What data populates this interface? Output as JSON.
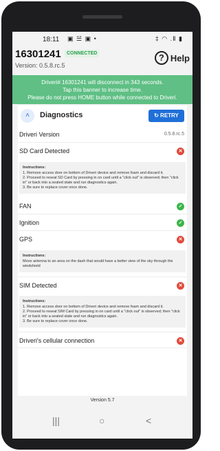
{
  "status_bar": {
    "time": "18:11",
    "left_icons": "▣ ☱ ▣ •",
    "right_icons": "‡ ◠ .Ⅱ ▮"
  },
  "header": {
    "device_id": "16301241",
    "connection_badge": "CONNECTED",
    "version": "Version: 0.5.8.rc.5",
    "help_label": "Help",
    "help_icon": "?"
  },
  "banner": {
    "line1": "Driveri# 16301241 will disconnect in 343 seconds.",
    "line2": "Tap this banner to increase time.",
    "line3": "Please do not press HOME button while connected to Driveri."
  },
  "diagnostics": {
    "title": "Diagnostics",
    "retry_label": "RETRY",
    "retry_icon": "↻",
    "chevron_icon": "˄",
    "driveri_version": {
      "label": "Driveri Version",
      "value": "0.5.8.rc.5"
    },
    "sd_card": {
      "label": "SD Card Detected",
      "instructions_title": "Instructions:",
      "steps": [
        "1. Remove access door on bottom of Driveri device and remove foam and discard it.",
        "2. Proceed to reseat SD Card by pressing in on card until a \"click out\" is observed; then \"click in\" or back into a seated state and run diagnostics again.",
        "3. Be sure to replace cover once done."
      ]
    },
    "fan": {
      "label": "FAN"
    },
    "ignition": {
      "label": "Ignition"
    },
    "gps": {
      "label": "GPS",
      "instructions_title": "Instructions:",
      "text": "Move antenna to an area on the dash that would have a better view of the sky through the windshield"
    },
    "sim": {
      "label": "SIM Detected",
      "instructions_title": "Instructions:",
      "steps": [
        "1. Remove access door on bottom of Driveri device and remove foam and discard it.",
        "2. Proceed to reseat SIM Card by pressing in on card until a \"click out\" is observed; then \"click in\" or back into a seated state and run diagnostics again.",
        "3. Be sure to replace cover once done."
      ]
    },
    "cellular": {
      "label": "Driveri's cellular connection"
    }
  },
  "footer": {
    "version": "Version 5.7"
  },
  "navigation": {
    "recents": "|||",
    "home": "○",
    "back": "<"
  },
  "colors": {
    "banner": "#5fbf84",
    "accent": "#1f6fd8",
    "ok": "#3cb54a",
    "error": "#e14a3c"
  }
}
